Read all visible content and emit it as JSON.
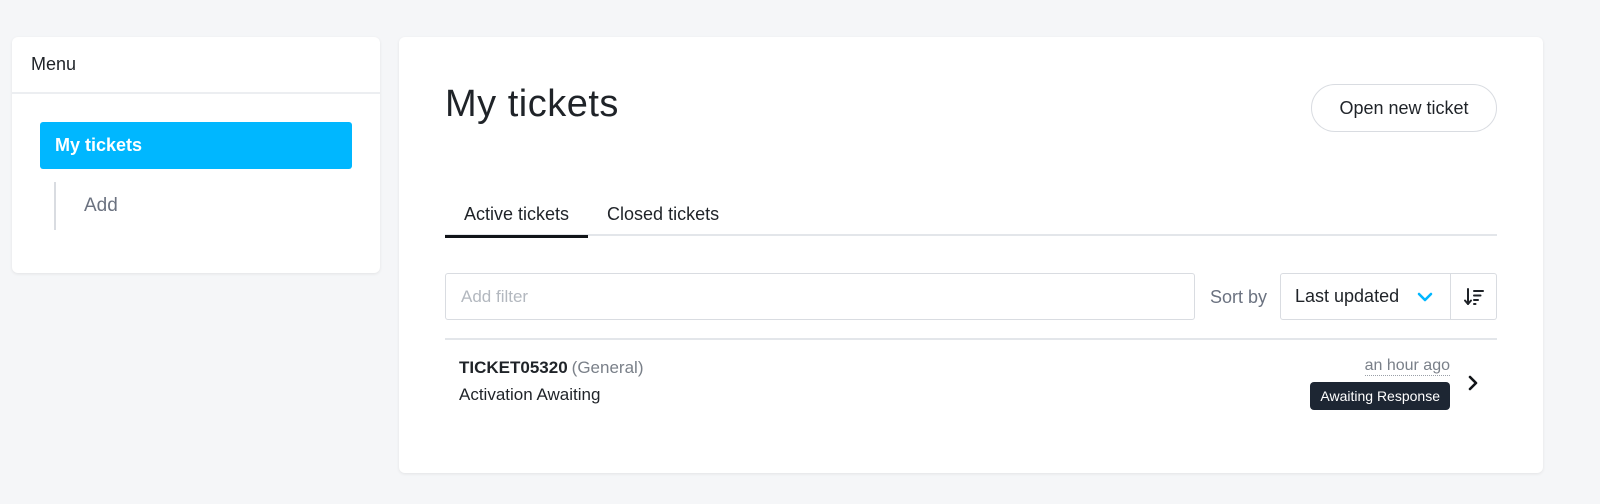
{
  "sidebar": {
    "title": "Menu",
    "items": [
      {
        "label": "My tickets",
        "active": true
      },
      {
        "label": "Add",
        "active": false
      }
    ]
  },
  "main": {
    "title": "My tickets",
    "new_ticket_label": "Open new ticket",
    "tabs": [
      {
        "label": "Active tickets",
        "active": true
      },
      {
        "label": "Closed tickets",
        "active": false
      }
    ],
    "filter": {
      "placeholder": "Add filter",
      "value": ""
    },
    "sort": {
      "label": "Sort by",
      "selected": "Last updated"
    },
    "tickets": [
      {
        "id": "TICKET05320",
        "category": "(General)",
        "subject": "Activation Awaiting",
        "updated": "an hour ago",
        "status": "Awaiting Response"
      }
    ]
  },
  "colors": {
    "accent": "#00b7ff",
    "badge": "#1d2633",
    "background": "#f5f6f8"
  },
  "icons": {
    "sort_chevron": "chevron-down-icon",
    "sort_direction": "sort-descending-icon",
    "row_arrow": "chevron-right-icon"
  }
}
